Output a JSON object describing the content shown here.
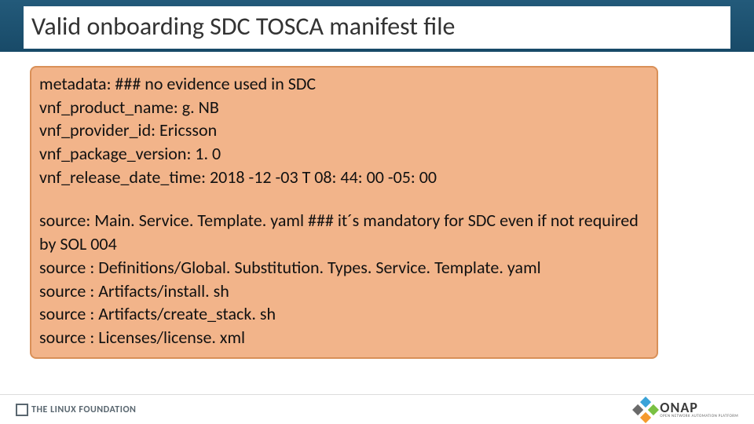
{
  "title": "Valid onboarding  SDC TOSCA manifest file",
  "manifest": {
    "line1": "metadata: ### no evidence used in SDC",
    "line2": "vnf_product_name: g. NB",
    "line3": "vnf_provider_id: Ericsson",
    "line4": "vnf_package_version: 1. 0",
    "line5": "vnf_release_date_time: 2018 -12 -03 T 08: 44: 00 -05: 00",
    "line6": "source: Main. Service. Template. yaml    ### it´s mandatory for SDC  even if not required by SOL 004",
    "line7": "source : Definitions/Global. Substitution. Types. Service. Template. yaml",
    "line8": "source : Artifacts/install. sh",
    "line9": "source : Artifacts/create_stack. sh",
    "line10": "source : Licenses/license. xml"
  },
  "footer": {
    "linux_foundation": "THE LINUX FOUNDATION",
    "onap": "ONAP",
    "onap_sub": "OPEN NETWORK AUTOMATION PLATFORM"
  }
}
